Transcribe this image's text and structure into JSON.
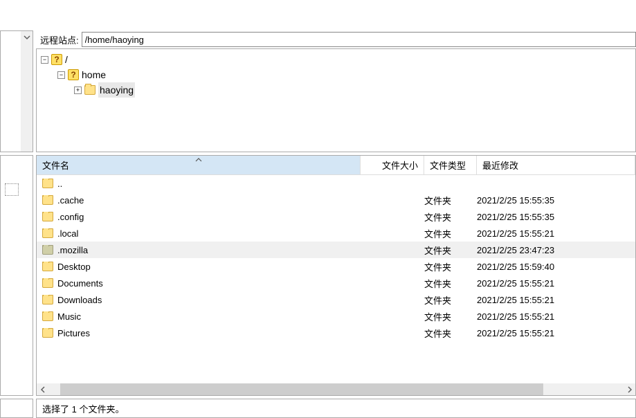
{
  "path_label": "远程站点:",
  "path_value": "/home/haoying",
  "tree": {
    "root": {
      "label": "/",
      "expander": "−"
    },
    "home": {
      "label": "home",
      "expander": "−"
    },
    "user": {
      "label": "haoying",
      "expander": "+"
    }
  },
  "columns": {
    "name": "文件名",
    "size": "文件大小",
    "type": "文件类型",
    "modified": "最近修改"
  },
  "files": [
    {
      "name": "..",
      "size": "",
      "type": "",
      "modified": "",
      "icon": "folder",
      "selected": false
    },
    {
      "name": ".cache",
      "size": "",
      "type": "文件夹",
      "modified": "2021/2/25 15:55:35",
      "icon": "folder",
      "selected": false
    },
    {
      "name": ".config",
      "size": "",
      "type": "文件夹",
      "modified": "2021/2/25 15:55:35",
      "icon": "folder",
      "selected": false
    },
    {
      "name": ".local",
      "size": "",
      "type": "文件夹",
      "modified": "2021/2/25 15:55:21",
      "icon": "folder",
      "selected": false
    },
    {
      "name": ".mozilla",
      "size": "",
      "type": "文件夹",
      "modified": "2021/2/25 23:47:23",
      "icon": "folder-dim",
      "selected": true
    },
    {
      "name": "Desktop",
      "size": "",
      "type": "文件夹",
      "modified": "2021/2/25 15:59:40",
      "icon": "folder",
      "selected": false
    },
    {
      "name": "Documents",
      "size": "",
      "type": "文件夹",
      "modified": "2021/2/25 15:55:21",
      "icon": "folder",
      "selected": false
    },
    {
      "name": "Downloads",
      "size": "",
      "type": "文件夹",
      "modified": "2021/2/25 15:55:21",
      "icon": "folder",
      "selected": false
    },
    {
      "name": "Music",
      "size": "",
      "type": "文件夹",
      "modified": "2021/2/25 15:55:21",
      "icon": "folder",
      "selected": false
    },
    {
      "name": "Pictures",
      "size": "",
      "type": "文件夹",
      "modified": "2021/2/25 15:55:21",
      "icon": "folder",
      "selected": false
    }
  ],
  "status": "选择了 1 个文件夹。",
  "glyphs": {
    "chevron_down": "⌄",
    "chevron_left": "‹",
    "chevron_right": "›",
    "question": "?"
  }
}
